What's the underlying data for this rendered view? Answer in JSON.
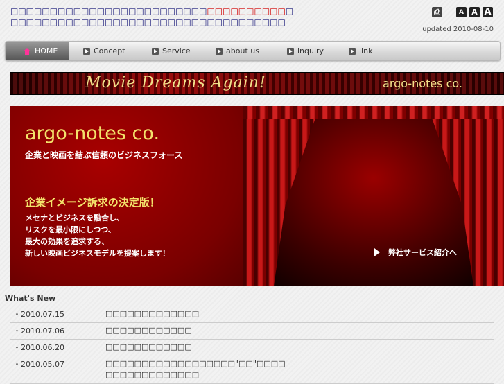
{
  "intro": {
    "line1_a": "□□□□□□□□□□□□□□□□□□□□□□□□□",
    "line1_highlight": "□□□□□□□□□□",
    "line1_b": "□",
    "line2": "□□□□□□□□□□□□□□□□□□□□□□□□□□□□□□□□□□□"
  },
  "tools": {
    "print_icon": "⎙",
    "font_small": "A",
    "font_medium": "A",
    "font_large": "A"
  },
  "updated": "updated 2010-08-10",
  "nav": {
    "home": "HOME",
    "concept": "Concept",
    "service": "Service",
    "about": "about us",
    "inquiry": "inquiry",
    "link": "link"
  },
  "banner": {
    "title": "Movie Dreams Again!",
    "brand": "argo-notes co."
  },
  "hero": {
    "brand": "argo-notes co.",
    "tagline": "企業と映画を結ぶ信頼のビジネスフォース",
    "heading": "企業イメージ訴求の決定版！",
    "body": [
      "メセナとビジネスを融合し、",
      "リスクを最小限にしつつ、",
      "最大の効果を追求する、",
      "新しい映画ビジネスモデルを提案します！"
    ],
    "link": "弊社サービス紹介へ"
  },
  "news": {
    "title": "What's New",
    "items": [
      {
        "date": "2010.07.15",
        "text": "□□□□□□□□□□□□□"
      },
      {
        "date": "2010.07.06",
        "text": "□□□□□□□□□□□□"
      },
      {
        "date": "2010.06.20",
        "text": "□□□□□□□□□□□□"
      },
      {
        "date": "2010.05.07",
        "text": "□□□□□□□□□□□□□□□□□□\"□□\"□□□□",
        "text2": "□□□□□□□□□□□□□"
      }
    ]
  }
}
